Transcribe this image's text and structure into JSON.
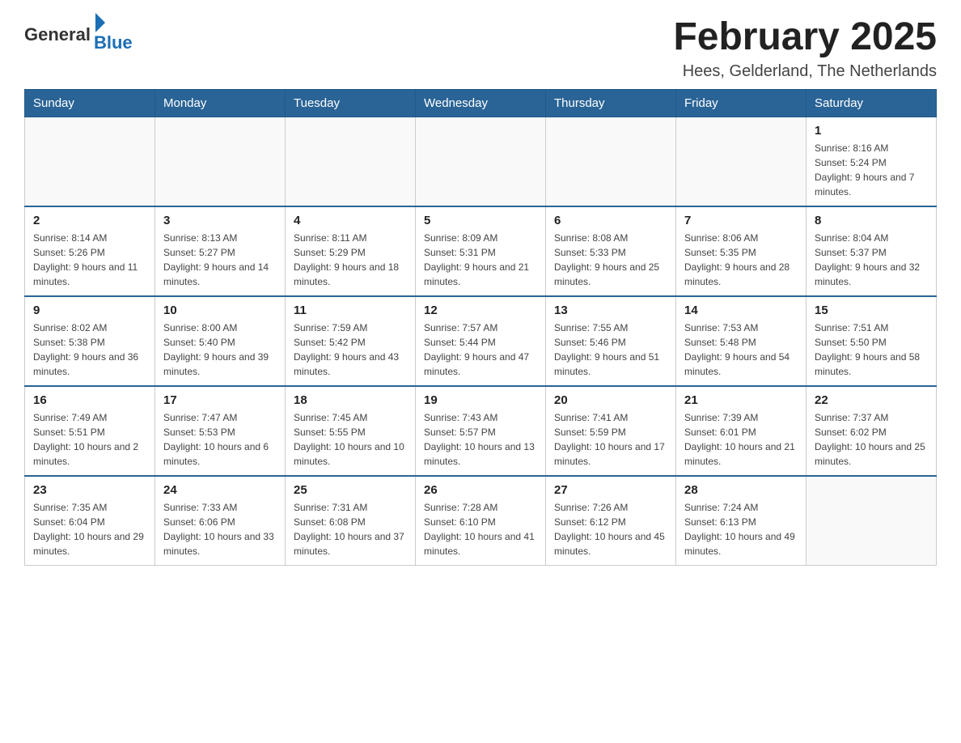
{
  "logo": {
    "text_general": "General",
    "text_blue": "Blue"
  },
  "header": {
    "title": "February 2025",
    "subtitle": "Hees, Gelderland, The Netherlands"
  },
  "weekdays": [
    "Sunday",
    "Monday",
    "Tuesday",
    "Wednesday",
    "Thursday",
    "Friday",
    "Saturday"
  ],
  "weeks": [
    [
      {
        "day": "",
        "info": ""
      },
      {
        "day": "",
        "info": ""
      },
      {
        "day": "",
        "info": ""
      },
      {
        "day": "",
        "info": ""
      },
      {
        "day": "",
        "info": ""
      },
      {
        "day": "",
        "info": ""
      },
      {
        "day": "1",
        "info": "Sunrise: 8:16 AM\nSunset: 5:24 PM\nDaylight: 9 hours and 7 minutes."
      }
    ],
    [
      {
        "day": "2",
        "info": "Sunrise: 8:14 AM\nSunset: 5:26 PM\nDaylight: 9 hours and 11 minutes."
      },
      {
        "day": "3",
        "info": "Sunrise: 8:13 AM\nSunset: 5:27 PM\nDaylight: 9 hours and 14 minutes."
      },
      {
        "day": "4",
        "info": "Sunrise: 8:11 AM\nSunset: 5:29 PM\nDaylight: 9 hours and 18 minutes."
      },
      {
        "day": "5",
        "info": "Sunrise: 8:09 AM\nSunset: 5:31 PM\nDaylight: 9 hours and 21 minutes."
      },
      {
        "day": "6",
        "info": "Sunrise: 8:08 AM\nSunset: 5:33 PM\nDaylight: 9 hours and 25 minutes."
      },
      {
        "day": "7",
        "info": "Sunrise: 8:06 AM\nSunset: 5:35 PM\nDaylight: 9 hours and 28 minutes."
      },
      {
        "day": "8",
        "info": "Sunrise: 8:04 AM\nSunset: 5:37 PM\nDaylight: 9 hours and 32 minutes."
      }
    ],
    [
      {
        "day": "9",
        "info": "Sunrise: 8:02 AM\nSunset: 5:38 PM\nDaylight: 9 hours and 36 minutes."
      },
      {
        "day": "10",
        "info": "Sunrise: 8:00 AM\nSunset: 5:40 PM\nDaylight: 9 hours and 39 minutes."
      },
      {
        "day": "11",
        "info": "Sunrise: 7:59 AM\nSunset: 5:42 PM\nDaylight: 9 hours and 43 minutes."
      },
      {
        "day": "12",
        "info": "Sunrise: 7:57 AM\nSunset: 5:44 PM\nDaylight: 9 hours and 47 minutes."
      },
      {
        "day": "13",
        "info": "Sunrise: 7:55 AM\nSunset: 5:46 PM\nDaylight: 9 hours and 51 minutes."
      },
      {
        "day": "14",
        "info": "Sunrise: 7:53 AM\nSunset: 5:48 PM\nDaylight: 9 hours and 54 minutes."
      },
      {
        "day": "15",
        "info": "Sunrise: 7:51 AM\nSunset: 5:50 PM\nDaylight: 9 hours and 58 minutes."
      }
    ],
    [
      {
        "day": "16",
        "info": "Sunrise: 7:49 AM\nSunset: 5:51 PM\nDaylight: 10 hours and 2 minutes."
      },
      {
        "day": "17",
        "info": "Sunrise: 7:47 AM\nSunset: 5:53 PM\nDaylight: 10 hours and 6 minutes."
      },
      {
        "day": "18",
        "info": "Sunrise: 7:45 AM\nSunset: 5:55 PM\nDaylight: 10 hours and 10 minutes."
      },
      {
        "day": "19",
        "info": "Sunrise: 7:43 AM\nSunset: 5:57 PM\nDaylight: 10 hours and 13 minutes."
      },
      {
        "day": "20",
        "info": "Sunrise: 7:41 AM\nSunset: 5:59 PM\nDaylight: 10 hours and 17 minutes."
      },
      {
        "day": "21",
        "info": "Sunrise: 7:39 AM\nSunset: 6:01 PM\nDaylight: 10 hours and 21 minutes."
      },
      {
        "day": "22",
        "info": "Sunrise: 7:37 AM\nSunset: 6:02 PM\nDaylight: 10 hours and 25 minutes."
      }
    ],
    [
      {
        "day": "23",
        "info": "Sunrise: 7:35 AM\nSunset: 6:04 PM\nDaylight: 10 hours and 29 minutes."
      },
      {
        "day": "24",
        "info": "Sunrise: 7:33 AM\nSunset: 6:06 PM\nDaylight: 10 hours and 33 minutes."
      },
      {
        "day": "25",
        "info": "Sunrise: 7:31 AM\nSunset: 6:08 PM\nDaylight: 10 hours and 37 minutes."
      },
      {
        "day": "26",
        "info": "Sunrise: 7:28 AM\nSunset: 6:10 PM\nDaylight: 10 hours and 41 minutes."
      },
      {
        "day": "27",
        "info": "Sunrise: 7:26 AM\nSunset: 6:12 PM\nDaylight: 10 hours and 45 minutes."
      },
      {
        "day": "28",
        "info": "Sunrise: 7:24 AM\nSunset: 6:13 PM\nDaylight: 10 hours and 49 minutes."
      },
      {
        "day": "",
        "info": ""
      }
    ]
  ]
}
